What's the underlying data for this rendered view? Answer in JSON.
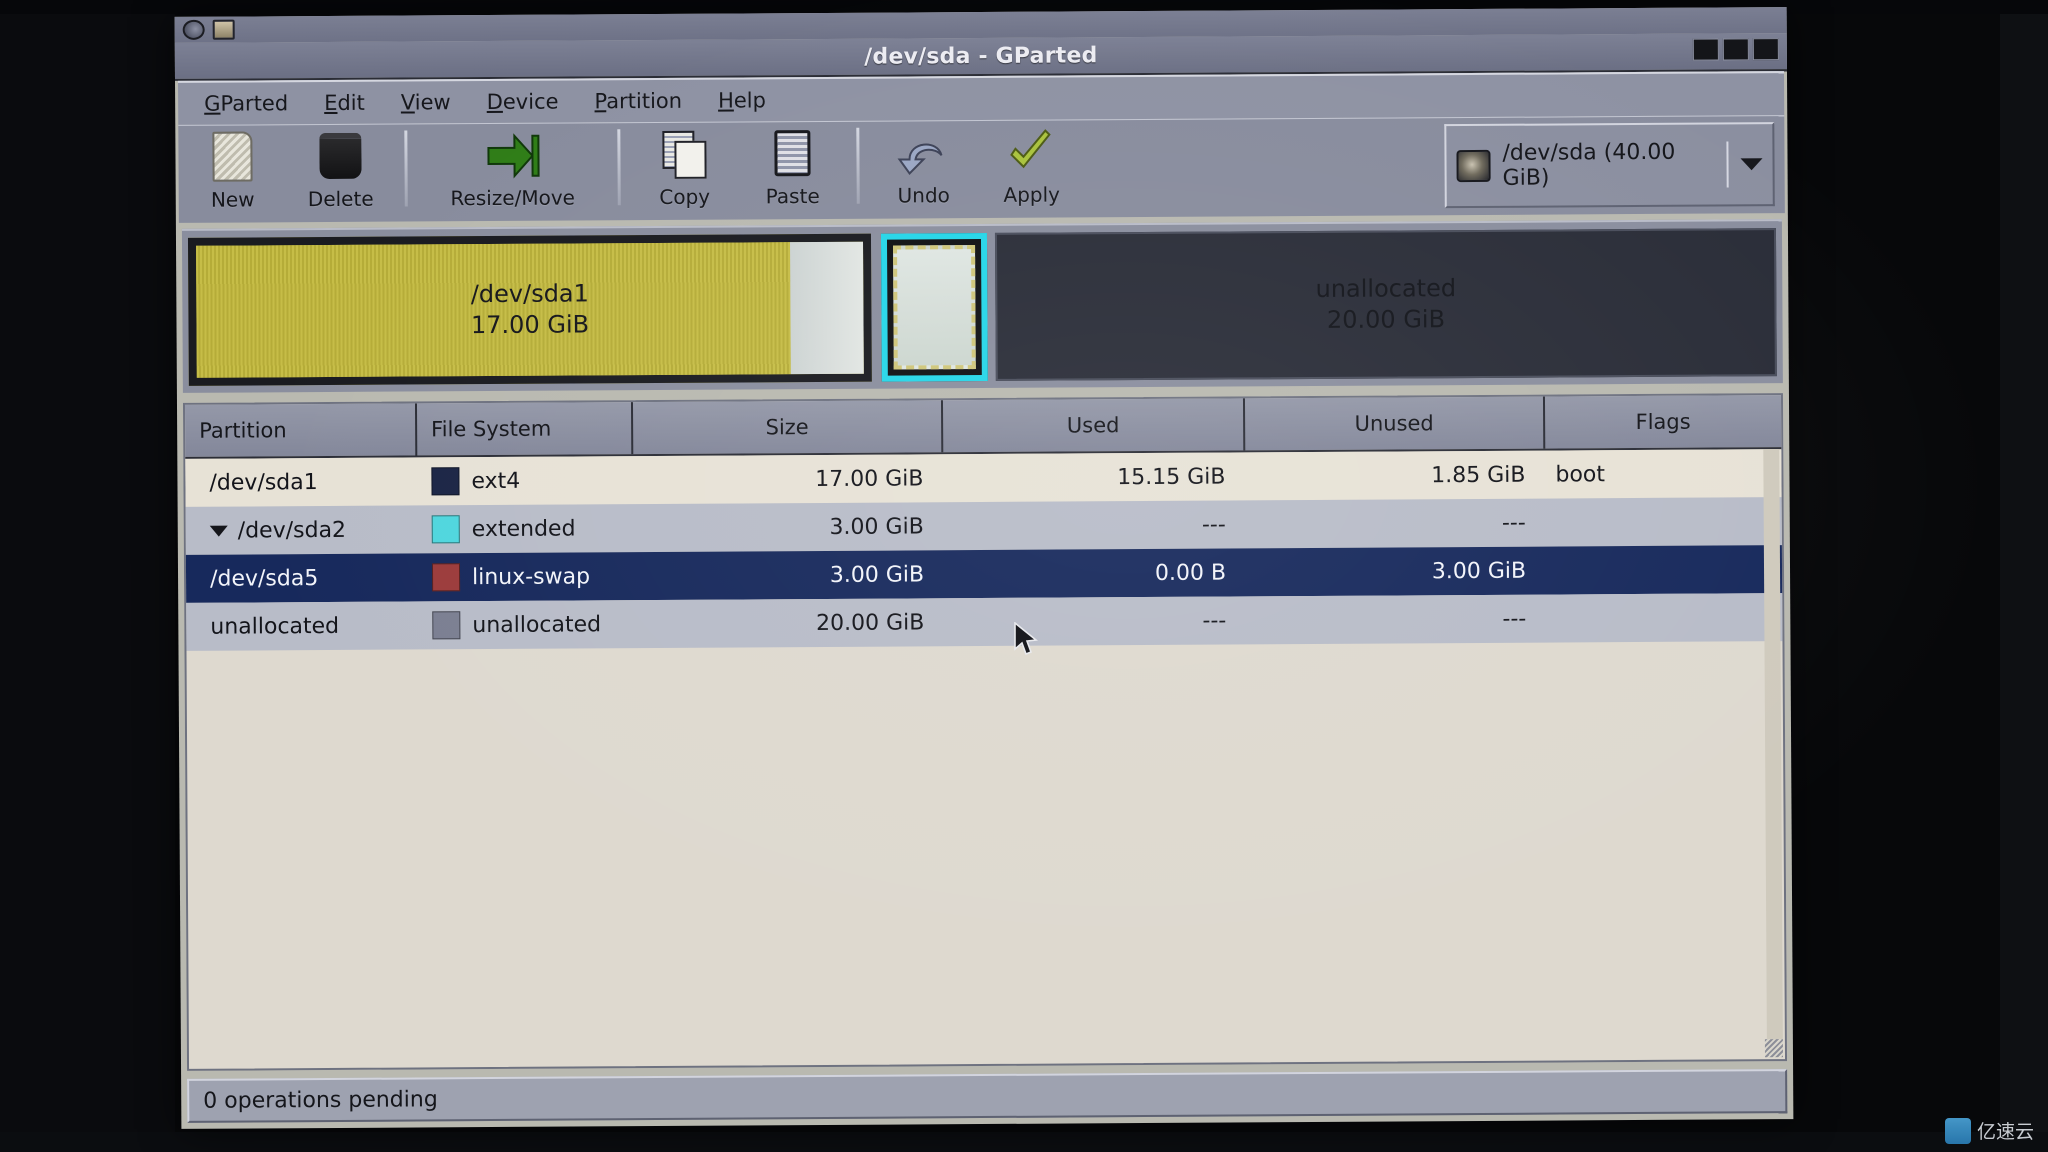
{
  "window": {
    "title": "/dev/sda - GParted",
    "controls": [
      "minimize-button",
      "maximize-button",
      "close-button"
    ]
  },
  "desktop_panel": {
    "icons": [
      "debian-swirl-icon",
      "terminal-icon"
    ]
  },
  "menubar": {
    "items": [
      {
        "mnemonic": "G",
        "rest": "Parted",
        "name": "menu-gparted"
      },
      {
        "mnemonic": "E",
        "rest": "dit",
        "name": "menu-edit"
      },
      {
        "mnemonic": "V",
        "rest": "iew",
        "name": "menu-view"
      },
      {
        "mnemonic": "D",
        "rest": "evice",
        "name": "menu-device"
      },
      {
        "mnemonic": "P",
        "rest": "artition",
        "name": "menu-partition"
      },
      {
        "mnemonic": "H",
        "rest": "elp",
        "name": "menu-help"
      }
    ]
  },
  "toolbar": {
    "buttons": [
      {
        "label": "New",
        "icon": "new-partition-icon"
      },
      {
        "label": "Delete",
        "icon": "delete-partition-icon"
      },
      {
        "label": "Resize/Move",
        "icon": "resize-move-icon"
      },
      {
        "label": "Copy",
        "icon": "copy-icon"
      },
      {
        "label": "Paste",
        "icon": "paste-icon"
      },
      {
        "label": "Undo",
        "icon": "undo-icon"
      },
      {
        "label": "Apply",
        "icon": "apply-checkmark-icon"
      }
    ],
    "device_selector": {
      "label": "/dev/sda  (40.00 GiB)",
      "icon": "harddisk-icon",
      "arrow": "chevron-down-icon"
    }
  },
  "disk_graphic": {
    "blocks": [
      {
        "name": "sda1",
        "title": "/dev/sda1",
        "size": "17.00 GiB",
        "color": "#b8b03d",
        "selected": false
      },
      {
        "name": "sda2-extended",
        "title": "",
        "size": "",
        "color": "#dfe6e2",
        "selected": true
      },
      {
        "name": "unallocated",
        "title": "unallocated",
        "size": "20.00 GiB",
        "color": "#2a2d38",
        "selected": false
      }
    ]
  },
  "table": {
    "headers": [
      "Partition",
      "File System",
      "Size",
      "Used",
      "Unused",
      "Flags"
    ],
    "rows": [
      {
        "partition": "/dev/sda1",
        "filesystem": "ext4",
        "size": "17.00 GiB",
        "used": "15.15 GiB",
        "unused": "1.85 GiB",
        "flags": "boot",
        "swatch": "#1b2545",
        "selected": false,
        "expander": false,
        "indent": false
      },
      {
        "partition": "/dev/sda2",
        "filesystem": "extended",
        "size": "3.00 GiB",
        "used": "---",
        "unused": "---",
        "flags": "",
        "swatch": "#4fd6dd",
        "selected": false,
        "expander": true,
        "indent": false
      },
      {
        "partition": "/dev/sda5",
        "filesystem": "linux-swap",
        "size": "3.00 GiB",
        "used": "0.00 B",
        "unused": "3.00 GiB",
        "flags": "",
        "swatch": "#9c3b3b",
        "selected": true,
        "expander": false,
        "indent": true
      },
      {
        "partition": "unallocated",
        "filesystem": "unallocated",
        "size": "20.00 GiB",
        "used": "---",
        "unused": "---",
        "flags": "",
        "swatch": "#7b7f92",
        "selected": false,
        "expander": false,
        "indent": false
      }
    ]
  },
  "statusbar": {
    "text": "0 operations pending"
  },
  "watermark": {
    "text": "亿速云"
  },
  "colors": {
    "selection": "#17295c",
    "extended_highlight": "#25d6e8",
    "ext4": "#b8b03d",
    "unallocated": "#2a2d38"
  }
}
